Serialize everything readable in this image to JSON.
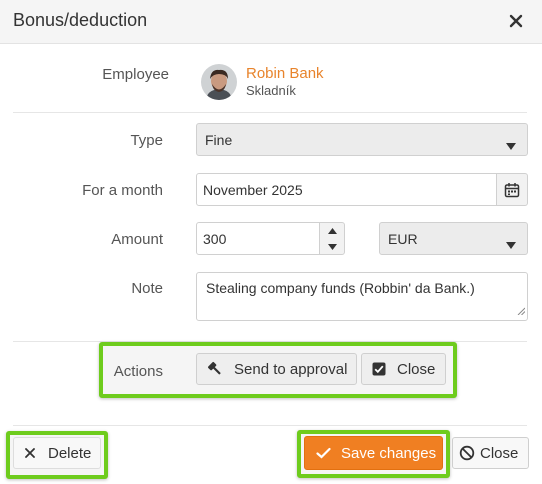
{
  "dialog": {
    "title": "Bonus/deduction"
  },
  "employee": {
    "label": "Employee",
    "name": "Robin Bank",
    "role": "Skladník"
  },
  "form": {
    "type_label": "Type",
    "type_value": "Fine",
    "month_label": "For a month",
    "month_value": "November 2025",
    "amount_label": "Amount",
    "amount_value": "300",
    "currency_value": "EUR",
    "note_label": "Note",
    "note_value": "Stealing company funds (Robbin' da Bank.)"
  },
  "actions": {
    "label": "Actions",
    "send_label": "Send to approval",
    "close_label": "Close"
  },
  "footer": {
    "delete_label": "Delete",
    "save_label": "Save changes",
    "close_label": "Close"
  },
  "colors": {
    "accent": "#f07f22",
    "highlight": "#6ecc1d",
    "employee_name": "#e8842c"
  }
}
